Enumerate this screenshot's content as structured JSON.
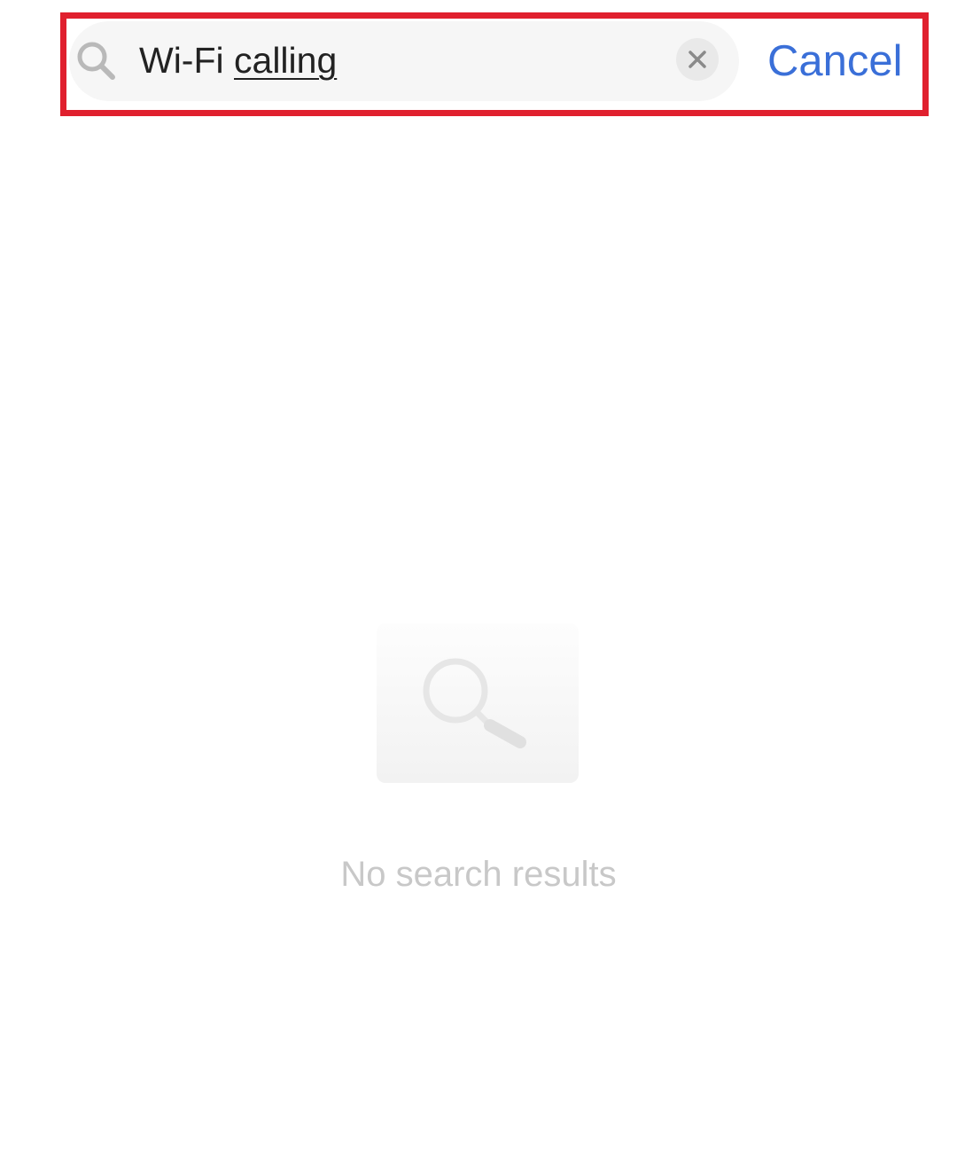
{
  "search": {
    "query_part1": "Wi-Fi ",
    "query_part2": "calling",
    "cancel_label": "Cancel"
  },
  "icons": {
    "search": "search-icon",
    "clear": "close-icon",
    "empty_state": "magnifier-icon"
  },
  "empty_state": {
    "message": "No search results"
  },
  "colors": {
    "highlight_border": "#e0202e",
    "cancel_text": "#3a6fd8",
    "search_bar_bg": "#f6f6f6",
    "empty_text": "#c8c8c8"
  }
}
